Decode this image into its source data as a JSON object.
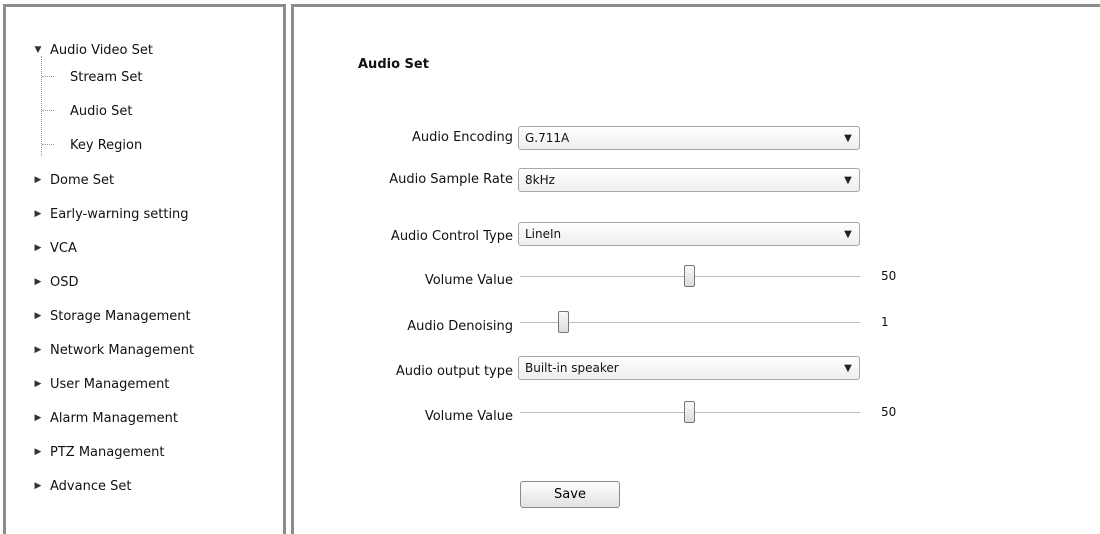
{
  "sidebar": {
    "expanded": {
      "label": "Audio Video Set",
      "children": [
        "Stream Set",
        "Audio Set",
        "Key Region"
      ]
    },
    "items": [
      "Dome Set",
      "Early-warning setting",
      "VCA",
      "OSD",
      "Storage Management",
      "Network Management",
      "User Management",
      "Alarm Management",
      "PTZ Management",
      "Advance Set"
    ]
  },
  "main": {
    "title": "Audio Set",
    "audio_encoding": {
      "label": "Audio Encoding",
      "value": "G.711A"
    },
    "sample_rate": {
      "label": "Audio Sample Rate",
      "value": "8kHz"
    },
    "control_type": {
      "label": "Audio Control Type",
      "value": "LineIn"
    },
    "volume_in": {
      "label": "Volume Value",
      "value": "50",
      "fraction": 0.5
    },
    "denoising": {
      "label": "Audio Denoising",
      "value": "1",
      "fraction": 0.12
    },
    "output_type": {
      "label": "Audio output type",
      "value": "Built-in speaker"
    },
    "volume_out": {
      "label": "Volume Value",
      "value": "50",
      "fraction": 0.5
    },
    "save_label": "Save"
  },
  "icons": {
    "expanded": "triangle-down-icon",
    "collapsed": "triangle-right-icon",
    "dropdown": "chevron-down-icon"
  }
}
